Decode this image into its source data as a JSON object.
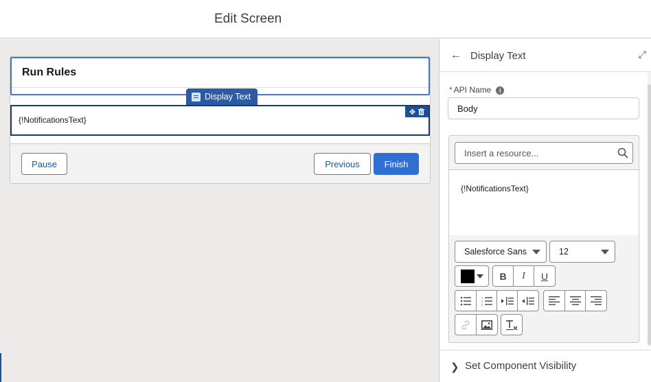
{
  "header": {
    "title": "Edit Screen"
  },
  "canvas": {
    "header_title": "Run Rules",
    "display_tag_label": "Display Text",
    "display_text_value": "{!NotificationsText}",
    "footer": {
      "pause": "Pause",
      "previous": "Previous",
      "finish": "Finish"
    }
  },
  "panel": {
    "title": "Display Text",
    "api_name_label": "API Name",
    "api_name_required": "*",
    "api_name_value": "Body",
    "resource_placeholder": "Insert a resource...",
    "editor_content": "{!NotificationsText}",
    "font_family": "Salesforce Sans",
    "font_size": "12",
    "text_color": "#000000",
    "visibility_label": "Set Component Visibility"
  },
  "colors": {
    "accent": "#2f6fd1",
    "selection": "#1b5297",
    "header_border": "#3d7ad7"
  }
}
